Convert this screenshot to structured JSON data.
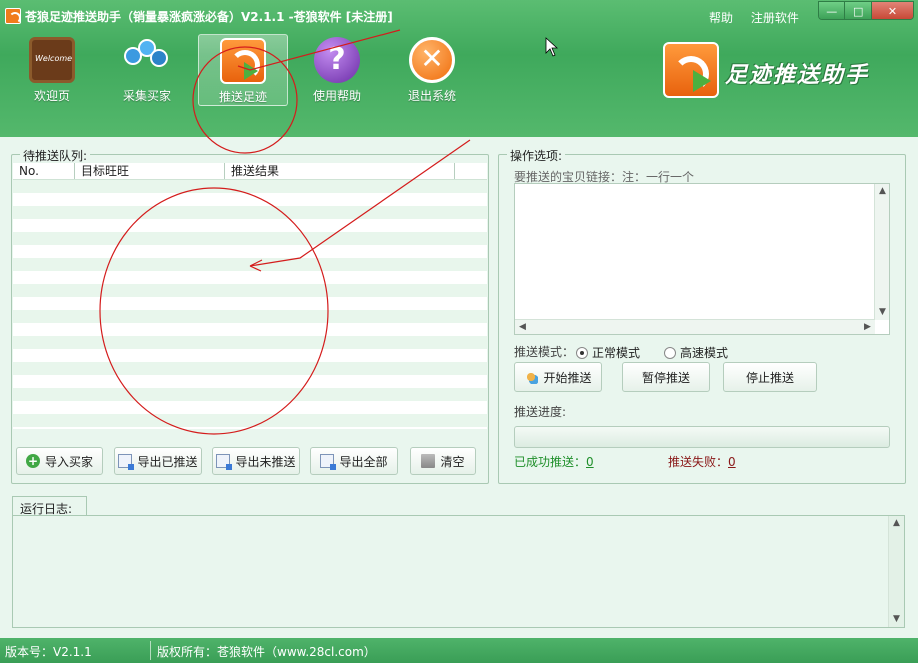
{
  "window": {
    "title": "苍狼足迹推送助手（销量暴涨疯涨必备）V2.1.1  -苍狼软件 [未注册]",
    "links": [
      "帮助",
      "注册软件"
    ],
    "controls": {
      "minimize": "—",
      "maximize": "□",
      "close": "✕"
    }
  },
  "toolbar": {
    "items": [
      {
        "label": "欢迎页",
        "icon": "welcome-board-icon"
      },
      {
        "label": "采集买家",
        "icon": "users-icon"
      },
      {
        "label": "推送足迹",
        "icon": "rss-push-icon",
        "active": true
      },
      {
        "label": "使用帮助",
        "icon": "help-icon",
        "glyph": "?"
      },
      {
        "label": "退出系统",
        "icon": "exit-icon",
        "glyph": "✕"
      }
    ]
  },
  "brand": {
    "text": "足迹推送助手"
  },
  "queue": {
    "title": "待推送队列:",
    "columns": [
      "No.",
      "目标旺旺",
      "推送结果"
    ],
    "rows": []
  },
  "queue_buttons": {
    "import_buyers": "导入买家",
    "export_pushed": "导出已推送",
    "export_unpushed": "导出未推送",
    "export_all": "导出全部",
    "clear": "清空"
  },
  "options": {
    "title": "操作选项:",
    "links_label": "要推送的宝贝链接：",
    "links_hint": "注：一行一个",
    "links_value": "",
    "mode_label": "推送模式：",
    "mode_normal": "正常模式",
    "mode_fast": "高速模式",
    "mode_selected": "normal",
    "start": "开始推送",
    "pause": "暂停推送",
    "stop": "停止推送",
    "progress_label": "推送进度:",
    "progress_value": 0,
    "success_label": "已成功推送：",
    "success_count": "0",
    "fail_label": "推送失败：",
    "fail_count": "0"
  },
  "colors": {
    "success": "#1f8f2a",
    "fail": "#8a1818",
    "accent": "#3fa95c",
    "annotation": "#d41c1c"
  },
  "log": {
    "tab": "运行日志:",
    "content": ""
  },
  "status": {
    "version": "版本号：V2.1.1",
    "copyright": "版权所有：苍狼软件（www.28cl.com）"
  }
}
